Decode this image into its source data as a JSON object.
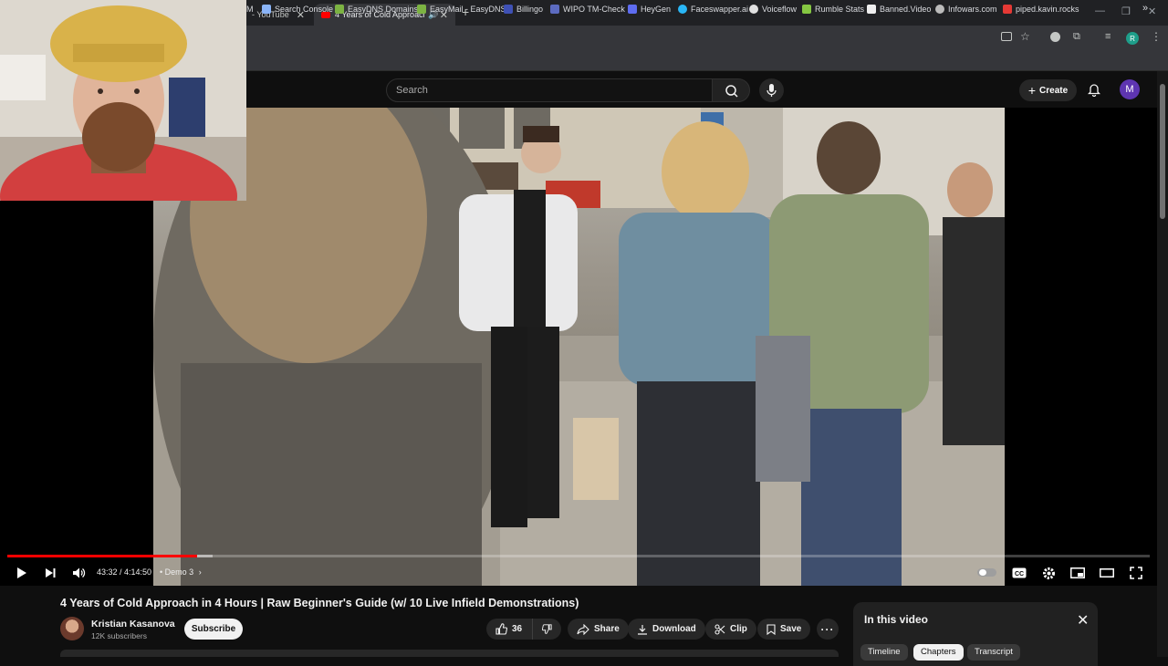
{
  "browser": {
    "tabs": [
      {
        "label": "- YouTube",
        "active": false
      },
      {
        "label": "4 Years of Cold Approach in",
        "active": true
      }
    ],
    "new_tab": "+",
    "bookmarks": [
      {
        "label": "M"
      },
      {
        "label": "Search Console"
      },
      {
        "label": "EasyDNS Domains"
      },
      {
        "label": "EasyMail - EasyDNS"
      },
      {
        "label": "Billingo"
      },
      {
        "label": "WIPO TM-Check"
      },
      {
        "label": "HeyGen"
      },
      {
        "label": "Faceswapper.ai"
      },
      {
        "label": "Voiceflow"
      },
      {
        "label": "Rumble Stats"
      },
      {
        "label": "Banned.Video"
      },
      {
        "label": "Infowars.com"
      },
      {
        "label": "piped.kavin.rocks"
      }
    ],
    "profile_initial": "R",
    "more_bookmarks": "»"
  },
  "youtube": {
    "search_placeholder": "Search",
    "create_label": "Create",
    "avatar_initial": "M"
  },
  "player": {
    "time": "43:32 / 4:14:50",
    "chapter": "• Demo 3",
    "progress_fraction": 0.166,
    "buffered_fraction": 0.18
  },
  "video": {
    "title": "4 Years of Cold Approach in 4 Hours | Raw Beginner's Guide (w/ 10 Live Infield Demonstrations)",
    "channel_name": "Kristian Kasanova",
    "subscribers": "12K subscribers",
    "subscribe_label": "Subscribe",
    "like_count": "36",
    "share_label": "Share",
    "download_label": "Download",
    "clip_label": "Clip",
    "save_label": "Save"
  },
  "chapters_panel": {
    "title": "In this video",
    "tabs": [
      "Timeline",
      "Chapters",
      "Transcript"
    ],
    "selected_tab": "Chapters"
  },
  "colors": {
    "accent_red": "#ff0000",
    "bg": "#0f0f0f"
  }
}
